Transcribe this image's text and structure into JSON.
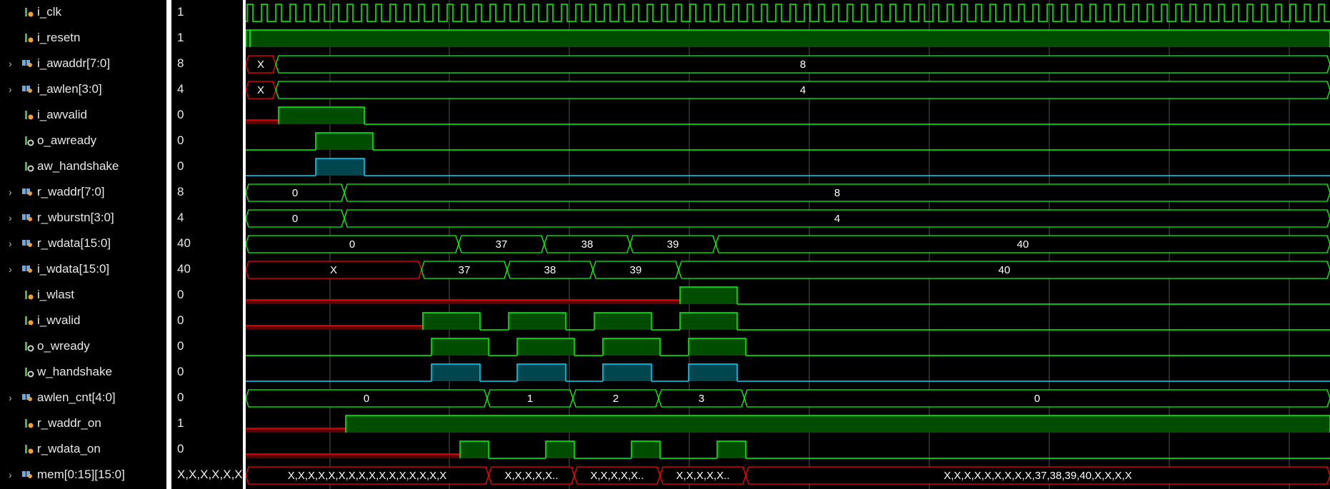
{
  "colors": {
    "high": "#00ff00",
    "fill_green": "#004d00",
    "undef": "#ff0000",
    "fill_red": "#5a0000",
    "handshake": "#00d7ff",
    "fill_hs": "#00464e",
    "cursor": "#ffffff"
  },
  "signals": [
    {
      "name": "i_clk",
      "value": "1",
      "kind": "in",
      "bus": false
    },
    {
      "name": "i_resetn",
      "value": "1",
      "kind": "in",
      "bus": false
    },
    {
      "name": "i_awaddr[7:0]",
      "value": "8",
      "kind": "busin",
      "bus": true
    },
    {
      "name": "i_awlen[3:0]",
      "value": "4",
      "kind": "busin",
      "bus": true
    },
    {
      "name": "i_awvalid",
      "value": "0",
      "kind": "in",
      "bus": false
    },
    {
      "name": "o_awready",
      "value": "0",
      "kind": "out",
      "bus": false
    },
    {
      "name": "aw_handshake",
      "value": "0",
      "kind": "out",
      "bus": false
    },
    {
      "name": "r_waddr[7:0]",
      "value": "8",
      "kind": "busin",
      "bus": true
    },
    {
      "name": "r_wburstn[3:0]",
      "value": "4",
      "kind": "busin",
      "bus": true
    },
    {
      "name": "r_wdata[15:0]",
      "value": "40",
      "kind": "busin",
      "bus": true
    },
    {
      "name": "i_wdata[15:0]",
      "value": "40",
      "kind": "busin",
      "bus": true
    },
    {
      "name": "i_wlast",
      "value": "0",
      "kind": "in",
      "bus": false
    },
    {
      "name": "i_wvalid",
      "value": "0",
      "kind": "in",
      "bus": false
    },
    {
      "name": "o_wready",
      "value": "0",
      "kind": "out",
      "bus": false
    },
    {
      "name": "w_handshake",
      "value": "0",
      "kind": "out",
      "bus": false
    },
    {
      "name": "awlen_cnt[4:0]",
      "value": "0",
      "kind": "busin",
      "bus": true
    },
    {
      "name": "r_waddr_on",
      "value": "1",
      "kind": "in",
      "bus": false
    },
    {
      "name": "r_wdata_on",
      "value": "0",
      "kind": "in",
      "bus": false
    },
    {
      "name": "mem[0:15][15:0]",
      "value": "X,X,X,X,X,X,X,X",
      "kind": "busin",
      "bus": true
    }
  ],
  "waves": [
    {
      "type": "clock"
    },
    {
      "type": "bit",
      "segs": [
        [
          0,
          6,
          "h"
        ],
        [
          6,
          1518,
          "h"
        ]
      ]
    },
    {
      "type": "bus",
      "segs": [
        [
          0,
          42,
          "X",
          "x"
        ],
        [
          42,
          1518,
          "8",
          "v"
        ]
      ]
    },
    {
      "type": "bus",
      "segs": [
        [
          0,
          42,
          "X",
          "x"
        ],
        [
          42,
          1518,
          "4",
          "v"
        ]
      ]
    },
    {
      "type": "bit",
      "segs": [
        [
          0,
          46,
          "x"
        ],
        [
          46,
          166,
          "h"
        ],
        [
          166,
          1518,
          "l"
        ]
      ]
    },
    {
      "type": "bit",
      "segs": [
        [
          0,
          98,
          "l"
        ],
        [
          98,
          178,
          "h"
        ],
        [
          178,
          1518,
          "l"
        ]
      ]
    },
    {
      "type": "hs",
      "segs": [
        [
          0,
          98,
          "l"
        ],
        [
          98,
          166,
          "h"
        ],
        [
          166,
          1518,
          "l"
        ]
      ]
    },
    {
      "type": "bus",
      "segs": [
        [
          0,
          138,
          "0",
          "v"
        ],
        [
          138,
          1518,
          "8",
          "v"
        ]
      ]
    },
    {
      "type": "bus",
      "segs": [
        [
          0,
          138,
          "0",
          "v"
        ],
        [
          138,
          1518,
          "4",
          "v"
        ]
      ]
    },
    {
      "type": "bus",
      "segs": [
        [
          0,
          298,
          "0",
          "v"
        ],
        [
          298,
          418,
          "37",
          "v"
        ],
        [
          418,
          538,
          "38",
          "v"
        ],
        [
          538,
          658,
          "39",
          "v"
        ],
        [
          658,
          1518,
          "40",
          "v"
        ]
      ]
    },
    {
      "type": "bus",
      "segs": [
        [
          0,
          246,
          "X",
          "x"
        ],
        [
          246,
          366,
          "37",
          "v"
        ],
        [
          366,
          486,
          "38",
          "v"
        ],
        [
          486,
          606,
          "39",
          "v"
        ],
        [
          606,
          1518,
          "40",
          "v"
        ]
      ]
    },
    {
      "type": "bit",
      "segs": [
        [
          0,
          608,
          "x"
        ],
        [
          608,
          688,
          "h"
        ],
        [
          688,
          1518,
          "l"
        ]
      ]
    },
    {
      "type": "bit",
      "segs": [
        [
          0,
          248,
          "x"
        ],
        [
          248,
          328,
          "h"
        ],
        [
          328,
          368,
          "l"
        ],
        [
          368,
          448,
          "h"
        ],
        [
          448,
          488,
          "l"
        ],
        [
          488,
          568,
          "h"
        ],
        [
          568,
          608,
          "l"
        ],
        [
          608,
          688,
          "h"
        ],
        [
          688,
          1518,
          "l"
        ]
      ]
    },
    {
      "type": "bit",
      "segs": [
        [
          0,
          260,
          "l"
        ],
        [
          260,
          340,
          "h"
        ],
        [
          340,
          380,
          "l"
        ],
        [
          380,
          460,
          "h"
        ],
        [
          460,
          500,
          "l"
        ],
        [
          500,
          580,
          "h"
        ],
        [
          580,
          620,
          "l"
        ],
        [
          620,
          700,
          "h"
        ],
        [
          700,
          1518,
          "l"
        ]
      ]
    },
    {
      "type": "hs",
      "segs": [
        [
          0,
          260,
          "l"
        ],
        [
          260,
          328,
          "h"
        ],
        [
          328,
          380,
          "l"
        ],
        [
          380,
          448,
          "h"
        ],
        [
          448,
          500,
          "l"
        ],
        [
          500,
          568,
          "h"
        ],
        [
          568,
          620,
          "l"
        ],
        [
          620,
          688,
          "h"
        ],
        [
          688,
          1518,
          "l"
        ]
      ]
    },
    {
      "type": "bus",
      "segs": [
        [
          0,
          338,
          "0",
          "v"
        ],
        [
          338,
          458,
          "1",
          "v"
        ],
        [
          458,
          578,
          "2",
          "v"
        ],
        [
          578,
          698,
          "3",
          "v"
        ],
        [
          698,
          1518,
          "0",
          "v"
        ]
      ]
    },
    {
      "type": "bit",
      "segs": [
        [
          0,
          140,
          "x"
        ],
        [
          140,
          1518,
          "h"
        ]
      ]
    },
    {
      "type": "bit",
      "segs": [
        [
          0,
          300,
          "x"
        ],
        [
          300,
          340,
          "h"
        ],
        [
          340,
          420,
          "l"
        ],
        [
          420,
          460,
          "h"
        ],
        [
          460,
          540,
          "l"
        ],
        [
          540,
          580,
          "h"
        ],
        [
          580,
          660,
          "l"
        ],
        [
          660,
          700,
          "h"
        ],
        [
          700,
          1518,
          "l"
        ]
      ]
    },
    {
      "type": "bus",
      "segs": [
        [
          0,
          340,
          "X,X,X,X,X,X,X,X,X,X,X,X,X,X,X,X",
          "x"
        ],
        [
          340,
          460,
          "X,X,X,X,X..",
          "x"
        ],
        [
          460,
          580,
          "X,X,X,X,X..",
          "x"
        ],
        [
          580,
          700,
          "X,X,X,X,X..",
          "x"
        ],
        [
          700,
          1518,
          "X,X,X,X,X,X,X,X,X,37,38,39,40,X,X,X,X",
          "x"
        ]
      ]
    }
  ]
}
